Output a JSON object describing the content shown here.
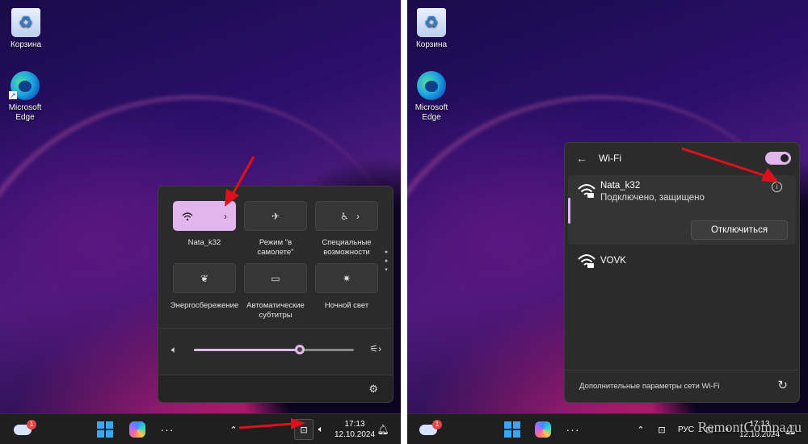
{
  "desktop": {
    "icons": [
      {
        "label": "Корзина",
        "icon": "recycle-bin-icon"
      },
      {
        "label": "Microsoft Edge",
        "icon": "edge-icon"
      }
    ]
  },
  "taskbar": {
    "weather_badge": "1",
    "time": "17:13",
    "date": "12.10.2024",
    "language": "РУС",
    "overflow_glyph": "···",
    "chevron_up": "⌃"
  },
  "quick_settings": {
    "tiles": [
      {
        "label": "Nata_k32",
        "icon": "wifi-icon",
        "active": true
      },
      {
        "label": "Режим \"в самолете\"",
        "icon": "airplane-icon",
        "active": false
      },
      {
        "label": "Специальные возможности",
        "icon": "accessibility-icon",
        "active": false
      },
      {
        "label": "Энергосбережение",
        "icon": "leaf-icon",
        "active": false
      },
      {
        "label": "Автоматические субтитры",
        "icon": "captions-icon",
        "active": false
      },
      {
        "label": "Ночной свет",
        "icon": "night-light-icon",
        "active": false
      }
    ],
    "volume_percent": 66
  },
  "wifi_panel": {
    "title": "Wi-Fi",
    "enabled": true,
    "networks": [
      {
        "name": "Nata_k32",
        "status": "Подключено, защищено",
        "connected": true
      },
      {
        "name": "VOVK",
        "status": "",
        "connected": false
      }
    ],
    "disconnect_label": "Отключиться",
    "more_settings_label": "Дополнительные параметры сети Wi-Fi"
  },
  "watermark": "RemontCompa.ru",
  "colors": {
    "accent": "#e2b6ec",
    "panel": "#2b2b2b",
    "taskbar": "#1f1f1f",
    "arrow": "#e0101a"
  }
}
